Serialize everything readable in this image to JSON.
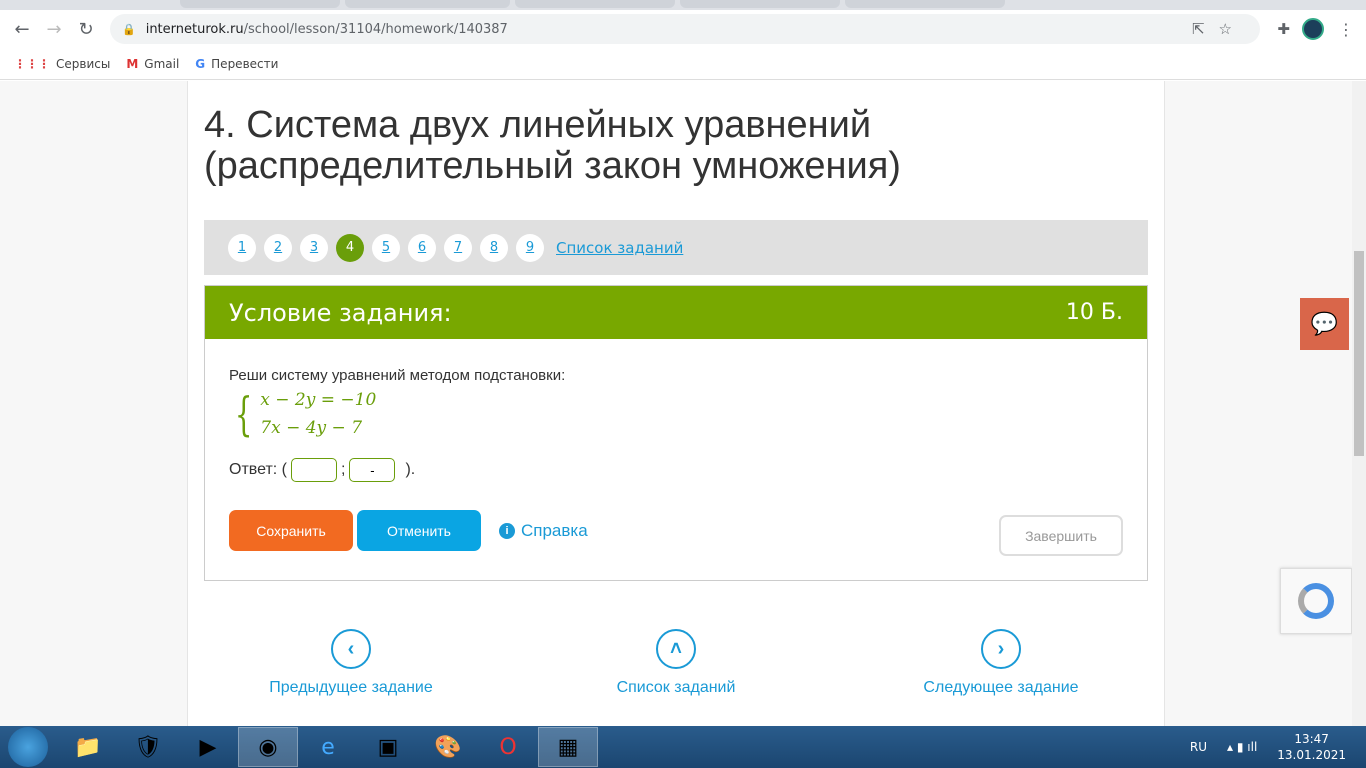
{
  "browser": {
    "url_host": "interneturok.ru",
    "url_path": "/school/lesson/31104/homework/140387",
    "bookmarks": [
      {
        "label": "Сервисы",
        "icon": "apps-icon"
      },
      {
        "label": "Gmail",
        "icon": "gmail-icon"
      },
      {
        "label": "Перевести",
        "icon": "translate-icon"
      }
    ]
  },
  "page": {
    "title": "4. Система двух линейных уравнений (распределительный закон умножения)",
    "pager": {
      "items": [
        "1",
        "2",
        "3",
        "4",
        "5",
        "6",
        "7",
        "8",
        "9"
      ],
      "active": "4",
      "list_label": "Список заданий"
    },
    "task": {
      "header": "Условие задания:",
      "points": "10 Б.",
      "prompt": "Реши систему уравнений методом подстановки:",
      "equations": [
        "x − 2y = −10",
        "7x − 4y − 7"
      ],
      "answer_label": "Ответ: (",
      "answer_sep": ";",
      "answer_end": ").",
      "answer_x": "",
      "answer_y": "-",
      "save": "Сохранить",
      "cancel": "Отменить",
      "help": "Справка",
      "finish": "Завершить"
    },
    "nav": {
      "prev": "Предыдущее задание",
      "list": "Список заданий",
      "next": "Следующее задание"
    }
  },
  "taskbar": {
    "lang": "RU",
    "time": "13:47",
    "date": "13.01.2021"
  }
}
